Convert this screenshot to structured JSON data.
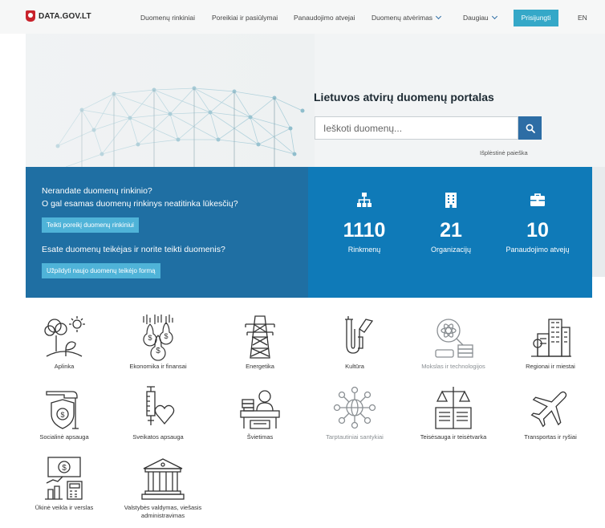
{
  "nav": {
    "logo_text": "DATA.GOV.LT",
    "links": [
      "Duomenų rinkiniai",
      "Poreikiai ir pasiūlymai",
      "Panaudojimo atvejai",
      "Duomenų atvėrimas",
      "Daugiau"
    ],
    "login": "Prisijungti",
    "language": "EN"
  },
  "hero": {
    "title": "Lietuvos atvirų duomenų portalas",
    "search_placeholder": "Ieškoti duomenų...",
    "advanced_search": "Išplėstinė paieška"
  },
  "request": {
    "question1": "Nerandate duomenų rinkinio?",
    "question2": "O gal esamas duomenų rinkinys neatitinka lūkesčių?",
    "button1": "Teikti poreikį duomenų rinkiniui",
    "question3": "Esate duomenų teikėjas ir norite teikti duomenis?",
    "button2": "Užpildyti naujo duomenų teikėjo formą"
  },
  "stats": [
    {
      "number": "1110",
      "label": "Rinkmenų",
      "icon": "sitemap-icon"
    },
    {
      "number": "21",
      "label": "Organizacijų",
      "icon": "building-icon"
    },
    {
      "number": "10",
      "label": "Panaudojimo atvejų",
      "icon": "briefcase-icon"
    }
  ],
  "categories": [
    {
      "label": "Aplinka",
      "icon": "environment-icon"
    },
    {
      "label": "Ekonomika ir finansai",
      "icon": "finance-icon"
    },
    {
      "label": "Energetika",
      "icon": "power-tower-icon"
    },
    {
      "label": "Kultūra",
      "icon": "trombone-icon"
    },
    {
      "label": "Mokslas ir technologijos",
      "icon": "science-icon"
    },
    {
      "label": "Regionai ir miestai",
      "icon": "city-icon"
    },
    {
      "label": "Socialinė apsauga",
      "icon": "social-protection-icon"
    },
    {
      "label": "Sveikatos apsauga",
      "icon": "health-icon"
    },
    {
      "label": "Švietimas",
      "icon": "education-icon"
    },
    {
      "label": "Tarptautiniai santykiai",
      "icon": "globe-network-icon"
    },
    {
      "label": "Teisėsauga ir teisėtvarka",
      "icon": "justice-icon"
    },
    {
      "label": "Transportas ir ryšiai",
      "icon": "airplane-icon"
    },
    {
      "label": "Ūkinė veikla ir verslas",
      "icon": "business-icon"
    },
    {
      "label": "Valstybės valdymas, viešasis administravimas",
      "icon": "government-icon"
    }
  ],
  "colors": {
    "primary_blue": "#2d6da5",
    "band_left": "#1f6fa3",
    "band_right": "#0f7ab8",
    "accent": "#35a8c8",
    "logo_red": "#c8222b"
  }
}
